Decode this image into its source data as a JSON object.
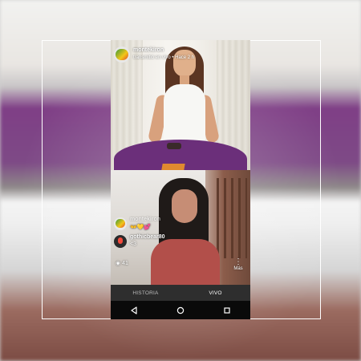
{
  "live": {
    "username": "montekiron",
    "subtitle": "transmitió en vivo • Hace 2 h"
  },
  "comments": [
    {
      "user": "montekiron",
      "text": "👐💛💕"
    },
    {
      "user": "gothicbear80",
      "text": "<3"
    }
  ],
  "viewers": {
    "count": "41",
    "icon": "eye-icon"
  },
  "more": {
    "label": "Más"
  },
  "tabs": {
    "history": "HISTORIA",
    "live": "VIVO"
  },
  "nav": {
    "back": "back-icon",
    "home": "home-icon",
    "recents": "recents-icon"
  },
  "colors": {
    "tabs_bg": "#2e2e2e",
    "nav_bg": "#0a0a0a",
    "table_purple": "#6b2f7a"
  }
}
